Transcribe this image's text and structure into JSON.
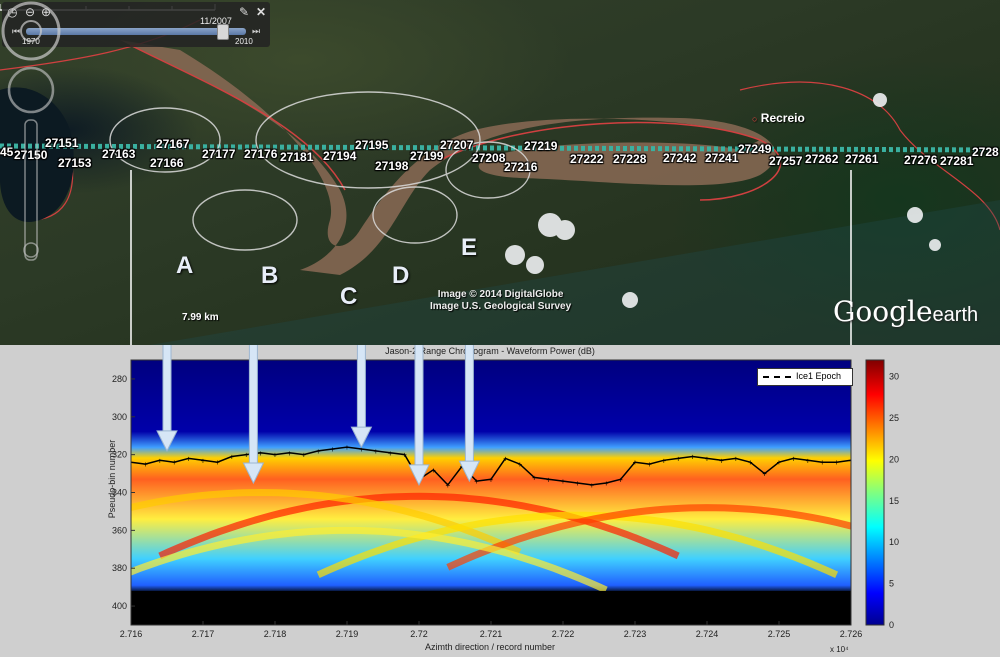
{
  "map": {
    "time_slider": {
      "date": "11/2007",
      "start": "1970",
      "end": "2010"
    },
    "track_labels": [
      "27150",
      "27151",
      "27153",
      "27163",
      "27167",
      "27166",
      "27177",
      "27176",
      "27181",
      "27194",
      "27195",
      "27198",
      "27199",
      "27207",
      "27208",
      "27216",
      "27219",
      "27222",
      "27228",
      "27242",
      "27241",
      "27249",
      "27257",
      "27262",
      "27261",
      "27276",
      "27281",
      "2728",
      "45"
    ],
    "annotations": [
      "A",
      "B",
      "C",
      "D",
      "E"
    ],
    "place_name": "Recreio",
    "credit_line1": "Image © 2014 DigitalGlobe",
    "credit_line2": "Image U.S. Geological Survey",
    "scale_label": "7.99  km",
    "logo_google": "Google",
    "logo_earth": "earth",
    "icons": [
      "clock-icon",
      "zoom-out-icon",
      "zoom-in-icon",
      "wrench-icon",
      "close-icon",
      "compass-icon",
      "pan-icon",
      "zoom-slider-icon"
    ]
  },
  "chart_data": {
    "type": "heatmap",
    "title": "Jason-2 Range Chronogram - Waveform Power (dB)",
    "xlabel": "Azimth direction / record number",
    "ylabel": "Pseudo-bin number",
    "x_exponent": "x 10⁴",
    "xlim": [
      2.716,
      2.726
    ],
    "ylim": [
      410,
      270
    ],
    "x_ticks": [
      "2.716",
      "2.717",
      "2.718",
      "2.719",
      "2.72",
      "2.721",
      "2.722",
      "2.723",
      "2.724",
      "2.725",
      "2.726"
    ],
    "y_ticks": [
      "280",
      "300",
      "320",
      "340",
      "360",
      "380",
      "400"
    ],
    "colorbar": {
      "min": 0,
      "max": 32,
      "ticks": [
        "0",
        "5",
        "10",
        "15",
        "20",
        "25",
        "30"
      ],
      "colormap": "jet"
    },
    "legend": {
      "label": "Ice1 Epoch",
      "position": "top-right"
    },
    "series": [
      {
        "name": "Ice1 Epoch",
        "x": [
          2.716,
          2.7162,
          2.7164,
          2.7166,
          2.7168,
          2.717,
          2.7172,
          2.7174,
          2.7176,
          2.7178,
          2.718,
          2.7182,
          2.7184,
          2.7186,
          2.7188,
          2.719,
          2.7192,
          2.7194,
          2.7196,
          2.7198,
          2.72,
          2.7202,
          2.7204,
          2.7206,
          2.7208,
          2.721,
          2.7212,
          2.7214,
          2.7216,
          2.7218,
          2.722,
          2.7222,
          2.7224,
          2.7226,
          2.7228,
          2.723,
          2.7232,
          2.7234,
          2.7236,
          2.7238,
          2.724,
          2.7242,
          2.7244,
          2.7246,
          2.7248,
          2.725,
          2.7252,
          2.7254,
          2.7256,
          2.7258,
          2.726
        ],
        "y": [
          324,
          325,
          323,
          324,
          322,
          323,
          324,
          321,
          320,
          319,
          320,
          319,
          320,
          318,
          317,
          316,
          317,
          318,
          319,
          320,
          333,
          328,
          336,
          326,
          334,
          333,
          322,
          325,
          332,
          333,
          334,
          335,
          336,
          335,
          333,
          324,
          325,
          323,
          322,
          321,
          322,
          323,
          322,
          324,
          330,
          324,
          322,
          323,
          324,
          324,
          323
        ]
      }
    ],
    "arrows": [
      {
        "label": "A",
        "x": 2.7165,
        "y_tip": 318
      },
      {
        "label": "B",
        "x": 2.7177,
        "y_tip": 335
      },
      {
        "label": "C",
        "x": 2.7192,
        "y_tip": 316
      },
      {
        "label": "D",
        "x": 2.72,
        "y_tip": 336
      },
      {
        "label": "E",
        "x": 2.7207,
        "y_tip": 334
      }
    ]
  }
}
